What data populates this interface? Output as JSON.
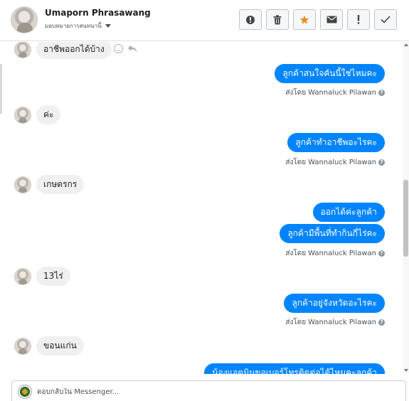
{
  "header": {
    "contact_name": "Umaporn Phrasawang",
    "assign_label": "มอบหมายการสนทนานี้",
    "tools": [
      {
        "name": "report-icon",
        "glyph": "!"
      },
      {
        "name": "trash-icon",
        "glyph": ""
      },
      {
        "name": "star-icon",
        "glyph": "★",
        "color": "#f08c2a"
      },
      {
        "name": "mail-icon",
        "glyph": ""
      },
      {
        "name": "exclamation-icon",
        "glyph": "!"
      },
      {
        "name": "check-icon",
        "glyph": "✓"
      }
    ]
  },
  "conversation": {
    "incoming": [
      {
        "text": "อาชีพออกได้บ้าง"
      },
      {
        "text": "ค่ะ"
      },
      {
        "text": "เกษตรกร"
      },
      {
        "text": "13ไร่"
      },
      {
        "text": "ขอนแก่น"
      }
    ],
    "outgoing": [
      {
        "text": "ลูกค้าสนใจคันนี้ใช่ไหมคะ"
      },
      {
        "text": "ลูกค้าทำอาชีพอะไรคะ"
      },
      {
        "text": "ออกได้ค่ะลูกค้า"
      },
      {
        "text": "ลูกค้ามีพื้นที่ทำกินกี่ไร่คะ"
      },
      {
        "text": "ลูกค้าอยู่จังหวัดอะไรคะ"
      },
      {
        "text": "น้องแอดมินขอเบอร์โทรติดต่อได้ไหมคะลูกค้า"
      }
    ],
    "sent_by_prefix": "ส่งโดย",
    "sent_by_name": "Wannaluck Pilawan"
  },
  "composer": {
    "placeholder": "ตอบกลับใน Messenger..."
  }
}
